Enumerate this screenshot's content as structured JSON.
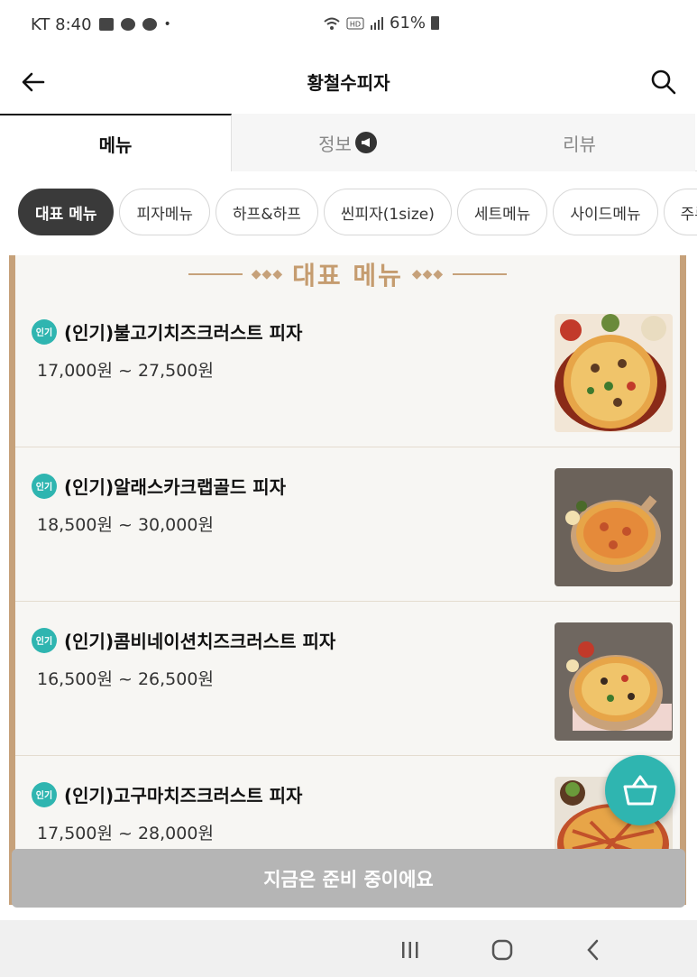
{
  "status_bar": {
    "carrier_time": "KT 8:40",
    "battery": "61%"
  },
  "app_bar": {
    "title": "황철수피자"
  },
  "tabs": [
    {
      "label": "메뉴",
      "active": true
    },
    {
      "label": "정보",
      "active": false
    },
    {
      "label": "리뷰",
      "active": false
    }
  ],
  "categories": [
    "대표 메뉴",
    "피자메뉴",
    "하프&하프",
    "씬피자(1size)",
    "세트메뉴",
    "사이드메뉴",
    "주류"
  ],
  "section": {
    "title": "대표 메뉴"
  },
  "menu_items": [
    {
      "badge": "인기",
      "name": "(인기)불고기치즈크러스트 피자",
      "price": "17,000원 ~ 27,500원"
    },
    {
      "badge": "인기",
      "name": "(인기)알래스카크랩골드 피자",
      "price": "18,500원 ~ 30,000원"
    },
    {
      "badge": "인기",
      "name": "(인기)콤비네이션치즈크러스트 피자",
      "price": "16,500원 ~ 26,500원"
    },
    {
      "badge": "인기",
      "name": "(인기)고구마치즈크러스트 피자",
      "price": "17,500원 ~ 28,000원"
    }
  ],
  "order_bar": {
    "label": "지금은 준비 중이에요"
  },
  "colors": {
    "accent": "#2fb5b0",
    "section_gold": "#c59c6f",
    "panel_border": "#c6a17a",
    "disabled_bar": "#b5b5b5"
  }
}
